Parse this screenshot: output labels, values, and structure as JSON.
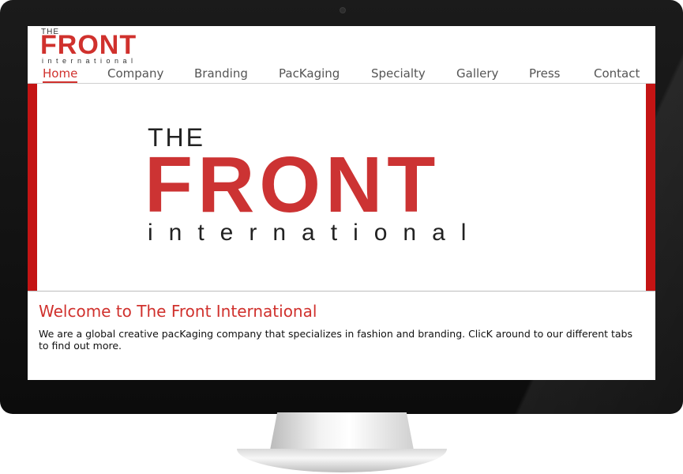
{
  "logo": {
    "line1": "THE",
    "line2": "FRONT",
    "line3": "international"
  },
  "nav": {
    "items": [
      {
        "label": "Home",
        "active": true
      },
      {
        "label": "Company"
      },
      {
        "label": "Branding"
      },
      {
        "label": "PacKaging"
      },
      {
        "label": "Specialty"
      },
      {
        "label": "Gallery"
      },
      {
        "label": "Press"
      },
      {
        "label": "Contact"
      }
    ]
  },
  "banner": {
    "line1": "THE",
    "line2": "FRONT",
    "line3": "international"
  },
  "welcome": {
    "title": "Welcome to The Front International",
    "text": "We are a global creative pacKaging company that specializes in fashion and branding. ClicK around to our different tabs to find out more."
  },
  "colors": {
    "accent": "#d0312d",
    "banner_bar": "#c41414",
    "bezel": "#111111"
  }
}
